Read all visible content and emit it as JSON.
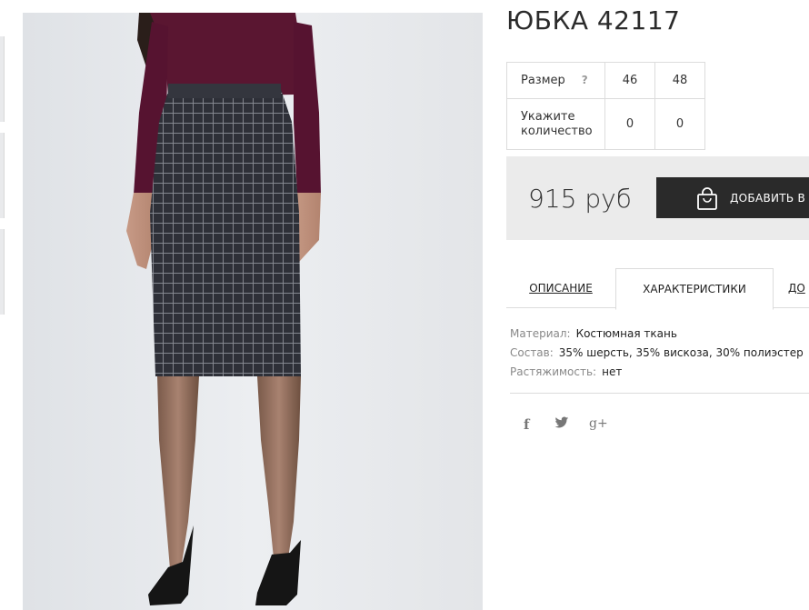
{
  "product": {
    "title": "ЮБКА 42117"
  },
  "sizes": {
    "size_label": "Размер",
    "help": "?",
    "values": [
      "46",
      "48"
    ],
    "qty_label": "Укажите количество",
    "quantities": [
      "0",
      "0"
    ]
  },
  "price": {
    "value": "915 руб",
    "cart_button": "ДОБАВИТЬ В З"
  },
  "tabs": [
    {
      "label": "ОПИСАНИЕ",
      "active": false
    },
    {
      "label": "ХАРАКТЕРИСТИКИ",
      "active": true
    },
    {
      "label": "ДО",
      "active": false
    }
  ],
  "specs": [
    {
      "key": "Материал:",
      "value": "Костюмная ткань"
    },
    {
      "key": "Состав:",
      "value": "35% шерсть, 35% вискоза, 30% полиэстер"
    },
    {
      "key": "Растяжимость:",
      "value": "нет"
    }
  ],
  "social": {
    "facebook": "f",
    "twitter": "twitter-icon",
    "googleplus": "g+"
  },
  "colors": {
    "button_bg": "#2a2a2a",
    "price_bg": "#ebebeb",
    "sweater": "#5a1631",
    "skirt": "#2e3038"
  }
}
